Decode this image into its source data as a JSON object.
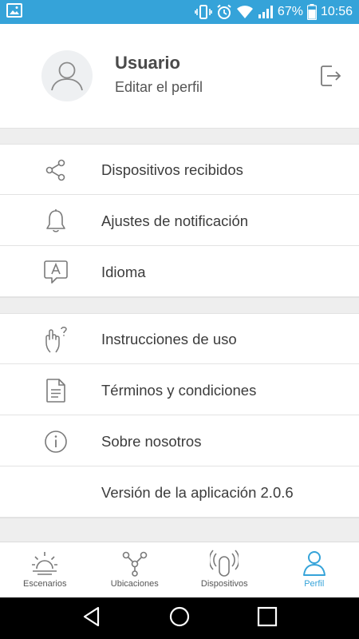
{
  "status_bar": {
    "battery_percent": "67%",
    "time": "10:56",
    "color": "#35a3d9"
  },
  "profile": {
    "name": "Usuario",
    "edit_label": "Editar el perfil"
  },
  "menu": {
    "received_devices": "Dispositivos recibidos",
    "notification_settings": "Ajustes de notificación",
    "language": "Idioma",
    "instructions": "Instrucciones de uso",
    "terms": "Términos y condiciones",
    "about": "Sobre nosotros",
    "app_version": "Versión de la aplicación 2.0.6"
  },
  "tabs": [
    {
      "label": "Escenarios",
      "icon": "sunrise-icon",
      "active": false
    },
    {
      "label": "Ubicaciones",
      "icon": "nodes-icon",
      "active": false
    },
    {
      "label": "Dispositivos",
      "icon": "device-signal-icon",
      "active": false
    },
    {
      "label": "Perfil",
      "icon": "person-icon",
      "active": true
    }
  ],
  "colors": {
    "accent": "#35a3d9",
    "icon_gray": "#7a7a7a",
    "separator": "#eeeeee"
  }
}
